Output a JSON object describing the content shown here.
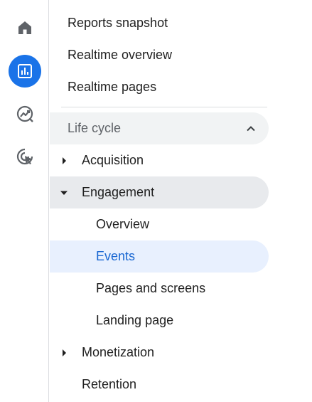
{
  "rail": {
    "items": [
      {
        "icon": "home-icon"
      },
      {
        "icon": "reports-bar-chart-icon",
        "active": true,
        "active_color": "#1a73e8"
      },
      {
        "icon": "explore-trend-icon"
      },
      {
        "icon": "advertising-target-cursor-icon"
      }
    ]
  },
  "nav": {
    "top_items": [
      {
        "label": "Reports snapshot"
      },
      {
        "label": "Realtime overview"
      },
      {
        "label": "Realtime pages"
      }
    ],
    "group": {
      "label": "Life cycle",
      "expanded": true,
      "items": [
        {
          "label": "Acquisition",
          "expanded": false
        },
        {
          "label": "Engagement",
          "expanded": true,
          "children": [
            {
              "label": "Overview"
            },
            {
              "label": "Events",
              "selected": true
            },
            {
              "label": "Pages and screens"
            },
            {
              "label": "Landing page"
            }
          ]
        },
        {
          "label": "Monetization",
          "expanded": false
        },
        {
          "label": "Retention"
        }
      ]
    }
  },
  "colors": {
    "selected_bg": "#e8f0fe",
    "selected_text": "#1967d2",
    "group_bg": "#f1f3f4",
    "expanded_bg": "#e8eaed"
  }
}
